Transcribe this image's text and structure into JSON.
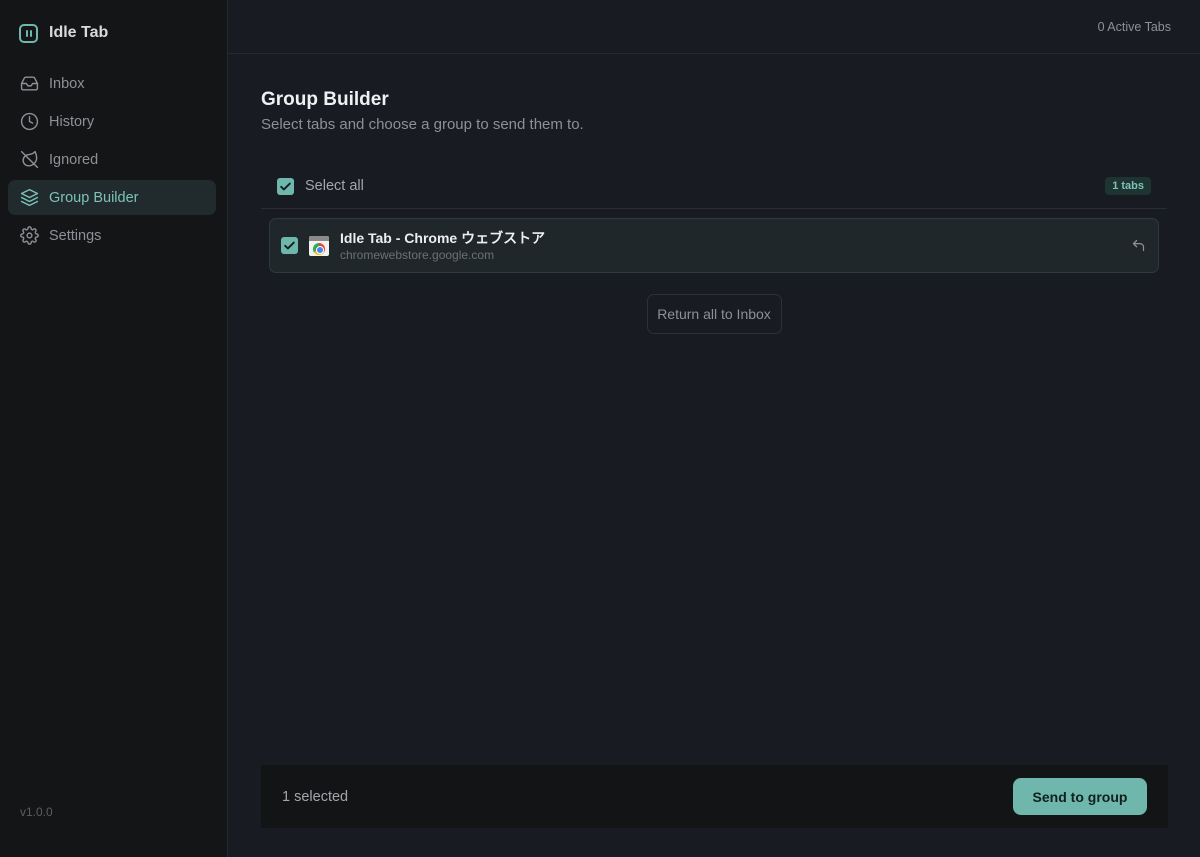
{
  "app": {
    "name": "Idle Tab",
    "version": "v1.0.0"
  },
  "sidebar": {
    "items": [
      {
        "label": "Inbox",
        "icon": "inbox-icon"
      },
      {
        "label": "History",
        "icon": "clock-icon"
      },
      {
        "label": "Ignored",
        "icon": "ignored-icon"
      },
      {
        "label": "Group Builder",
        "icon": "layers-icon",
        "active": true
      },
      {
        "label": "Settings",
        "icon": "gear-icon"
      }
    ]
  },
  "topbar": {
    "active_tabs": "0 Active Tabs"
  },
  "page": {
    "title": "Group Builder",
    "subtitle": "Select tabs and choose a group to send them to."
  },
  "list": {
    "select_all_label": "Select all",
    "select_all_checked": true,
    "count_badge": "1 tabs",
    "tabs": [
      {
        "title": "Idle Tab - Chrome ウェブストア",
        "url": "chromewebstore.google.com",
        "checked": true,
        "favicon": "chrome-web-store-icon"
      }
    ],
    "return_all_label": "Return all to Inbox"
  },
  "footer": {
    "selected_text": "1 selected",
    "send_label": "Send to group"
  },
  "colors": {
    "accent": "#6fb7ad",
    "sidebar_bg": "#141517",
    "main_bg": "#181b21",
    "active_nav_bg": "#212a2c"
  }
}
